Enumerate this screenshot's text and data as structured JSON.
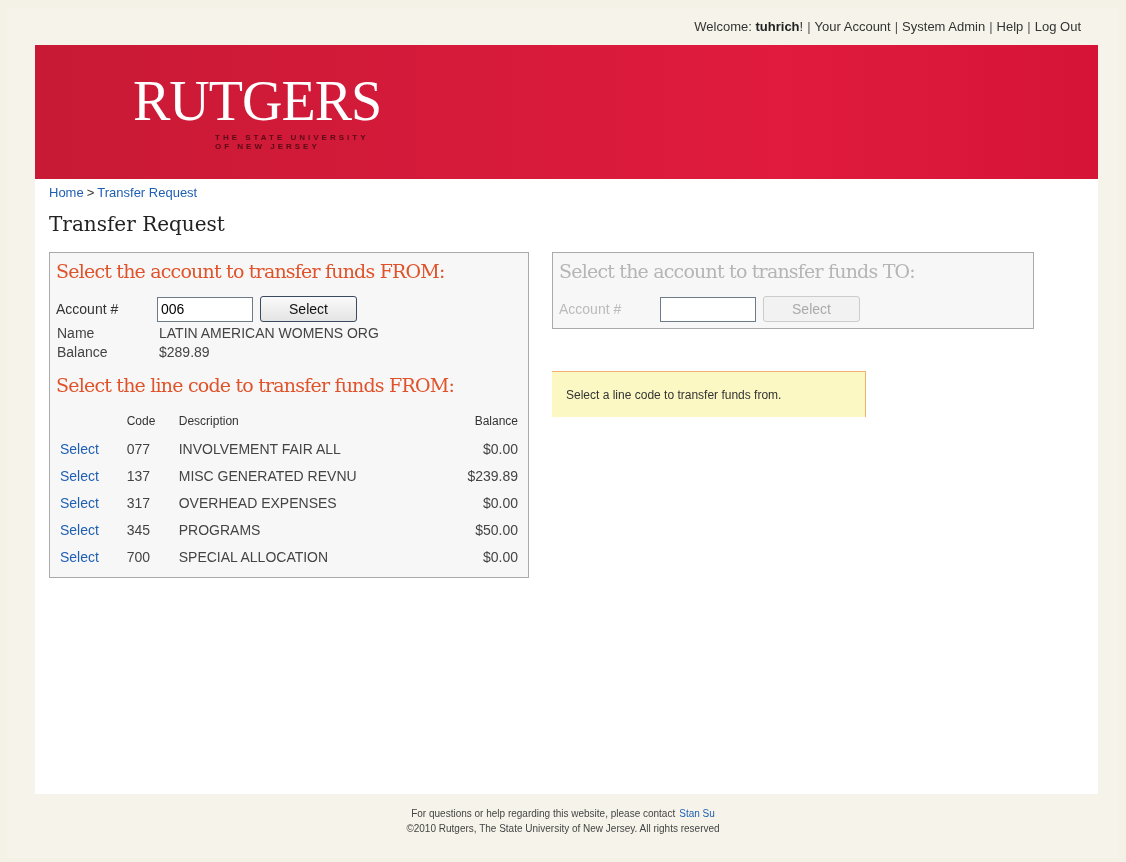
{
  "top_bar": {
    "welcome": "Welcome: **tuhrich**!",
    "links": [
      "Your Account",
      "System Admin",
      "Help",
      "Log Out"
    ],
    "separator": "|"
  },
  "banner": {
    "logo": "RUTGERS",
    "tagline_lines": [
      "THE STATE UNIVERSITY",
      "OF NEW JERSEY"
    ]
  },
  "breadcrumb": {
    "items": [
      "Home",
      "Transfer Request"
    ],
    "separator": ">"
  },
  "page_title": "Transfer Request",
  "from_panel": {
    "heading": "Select the account to transfer funds FROM:",
    "account_label": "Account #",
    "account_value": "006",
    "button": "Select",
    "disabled": false,
    "info": [
      {
        "label": "Name",
        "value": "LATIN AMERICAN WOMENS ORG"
      },
      {
        "label": "Balance",
        "value": "$289.89"
      }
    ],
    "line_heading": "Select the line code to transfer funds FROM:",
    "table": {
      "columns": [
        "Code",
        "Description",
        "Balance"
      ],
      "rows": [
        {
          "action": "Select",
          "code": "077",
          "description": "INVOLVEMENT FAIR ALL",
          "balance": "$0.00"
        },
        {
          "action": "Select",
          "code": "137",
          "description": "MISC GENERATED REVNU",
          "balance": "$239.89"
        },
        {
          "action": "Select",
          "code": "317",
          "description": "OVERHEAD EXPENSES",
          "balance": "$0.00"
        },
        {
          "action": "Select",
          "code": "345",
          "description": "PROGRAMS",
          "balance": "$50.00"
        },
        {
          "action": "Select",
          "code": "700",
          "description": "SPECIAL ALLOCATION",
          "balance": "$0.00"
        }
      ]
    }
  },
  "to_panel": {
    "heading": "Select the account to transfer funds TO:",
    "account_label": "Account #",
    "button": "Select",
    "disabled": true
  },
  "notice": "Select a line code to transfer funds from.",
  "footer": {
    "contact_text": "For questions or help regarding this website, please contact",
    "contact_link": "Stan Su",
    "copyright": "©2010 Rutgers, The State University of New Jersey. All rights reserved"
  }
}
